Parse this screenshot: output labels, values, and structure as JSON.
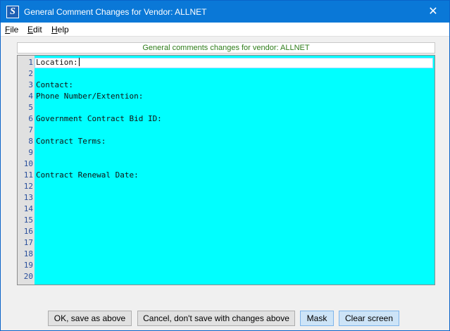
{
  "window": {
    "title": "General Comment Changes for Vendor: ALLNET",
    "app_icon_letter": "S",
    "close_glyph": "✕"
  },
  "menu": {
    "items": [
      {
        "mnemonic": "F",
        "rest": "ile"
      },
      {
        "mnemonic": "E",
        "rest": "dit"
      },
      {
        "mnemonic": "H",
        "rest": "elp"
      }
    ]
  },
  "header": {
    "text": "General comments changes for vendor: ALLNET",
    "color": "#2e7d1a"
  },
  "editor": {
    "background_color": "#00ffff",
    "lines": [
      {
        "num": "1",
        "text": "Location:"
      },
      {
        "num": "2",
        "text": ""
      },
      {
        "num": "3",
        "text": "Contact:"
      },
      {
        "num": "4",
        "text": "Phone Number/Extention:"
      },
      {
        "num": "5",
        "text": ""
      },
      {
        "num": "6",
        "text": "Government Contract Bid ID:"
      },
      {
        "num": "7",
        "text": ""
      },
      {
        "num": "8",
        "text": "Contract Terms:"
      },
      {
        "num": "9",
        "text": ""
      },
      {
        "num": "10",
        "text": ""
      },
      {
        "num": "11",
        "text": "Contract Renewal Date:"
      },
      {
        "num": "12",
        "text": ""
      },
      {
        "num": "13",
        "text": ""
      },
      {
        "num": "14",
        "text": ""
      },
      {
        "num": "15",
        "text": ""
      },
      {
        "num": "16",
        "text": ""
      },
      {
        "num": "17",
        "text": ""
      },
      {
        "num": "18",
        "text": ""
      },
      {
        "num": "19",
        "text": ""
      },
      {
        "num": "20",
        "text": ""
      }
    ]
  },
  "buttons": {
    "ok": "OK, save as above",
    "cancel": "Cancel, don't save with changes above",
    "mask": "Mask",
    "clear": "Clear screen"
  }
}
